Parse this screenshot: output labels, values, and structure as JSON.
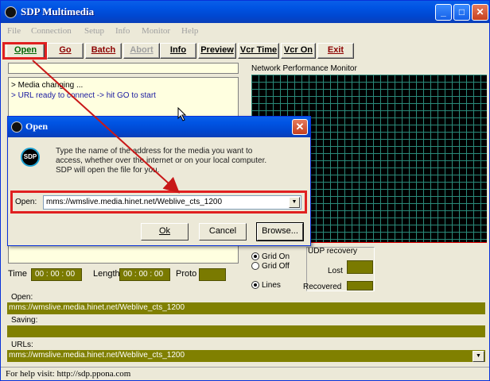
{
  "window": {
    "title": "SDP Multimedia",
    "logo_text": "SDP"
  },
  "menu": [
    "File",
    "Connection",
    "Setup",
    "Info",
    "Monitor",
    "Help"
  ],
  "toolbar": {
    "open": "Open",
    "go": "Go",
    "batch": "Batch",
    "abort": "Abort",
    "info": "Info",
    "preview": "Preview",
    "vcr_time": "Vcr Time",
    "vcr_on": "Vcr On",
    "exit": "Exit"
  },
  "log": {
    "lines": [
      "> Media changing ...",
      "> URL ready to connect -> hit GO to start"
    ]
  },
  "time": {
    "time_label": "Time",
    "time_value": "00 : 00 : 00",
    "length_label": "Length",
    "length_value": "00 : 00 : 00",
    "proto_label": "Proto",
    "proto_value": ""
  },
  "monitor": {
    "title": "Network Performance Monitor"
  },
  "grid_options": {
    "on": "Grid On",
    "off": "Grid Off",
    "lines": "Lines"
  },
  "udp": {
    "title": "UDP recovery",
    "lost_label": "Lost",
    "recovered_label": "Recovered"
  },
  "status": {
    "open_label": "Open:",
    "open_value": "mms://wmslive.media.hinet.net/Weblive_cts_1200",
    "saving_label": "Saving:",
    "saving_value": "",
    "urls_label": "URLs:",
    "urls_value": "mms://wmslive.media.hinet.net/Weblive_cts_1200"
  },
  "statusbar": "For help visit: http://sdp.ppona.com",
  "dialog": {
    "title": "Open",
    "icon_text": "SDP",
    "message": "Type the name of the address for the media you want to access, whether over the internet or on your local computer. SDP will open the file for you.",
    "open_label": "Open:",
    "open_value": "mms://wmslive.media.hinet.net/Weblive_cts_1200",
    "ok": "Ok",
    "cancel": "Cancel",
    "browse": "Browse..."
  },
  "colors": {
    "titlebar": "#0054e3",
    "highlight": "#e02020",
    "olive": "#808000",
    "monitor_grid": "#2a8a7a"
  }
}
